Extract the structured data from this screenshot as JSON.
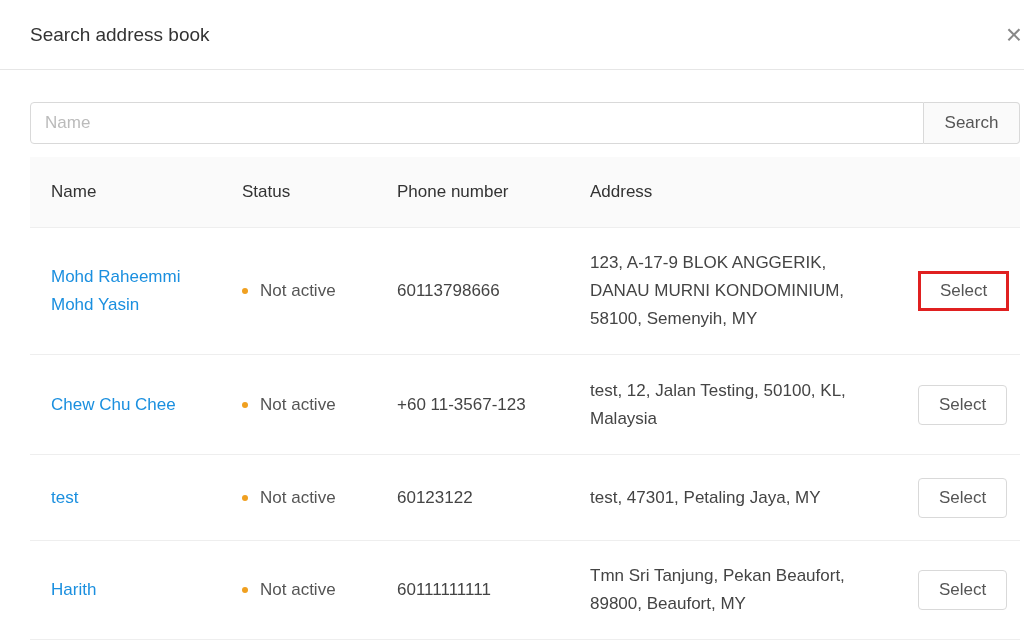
{
  "dialog": {
    "title": "Search address book",
    "close": "×"
  },
  "search": {
    "placeholder": "Name",
    "button": "Search"
  },
  "table": {
    "columns": [
      "Name",
      "Status",
      "Phone number",
      "Address"
    ],
    "rows": [
      {
        "name": "Mohd Raheemmi Mohd Yasin",
        "status": "Not active",
        "color": "#f0a020",
        "phone": "60113798666",
        "address": "123, A-17-9 BLOK ANGGERIK, DANAU MURNI KONDOMINIUM, 58100, Semenyih, MY",
        "action": "Select",
        "highlighted": true
      },
      {
        "name": "Chew Chu Chee",
        "status": "Not active",
        "color": "#f0a020",
        "phone": "+60 11-3567-123",
        "address": "test, 12, Jalan Testing, 50100, KL, Malaysia",
        "action": "Select",
        "highlighted": false
      },
      {
        "name": "test",
        "status": "Not active",
        "color": "#f0a020",
        "phone": "60123122",
        "address": "test, 47301, Petaling Jaya, MY",
        "action": "Select",
        "highlighted": false
      },
      {
        "name": "Harith",
        "status": "Not active",
        "color": "#f0a020",
        "phone": "60111111111",
        "address": "Tmn Sri Tanjung, Pekan Beaufort, 89800, Beaufort, MY",
        "action": "Select",
        "highlighted": false
      }
    ]
  }
}
